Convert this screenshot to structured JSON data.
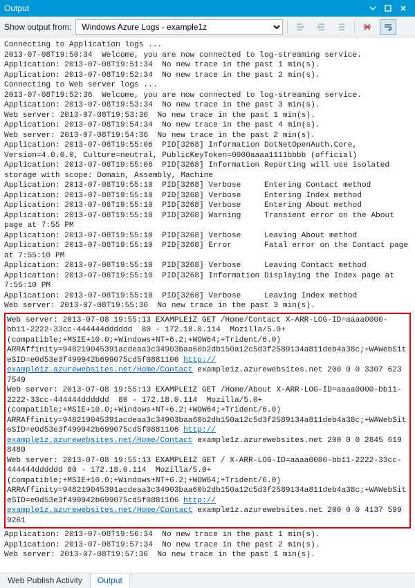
{
  "titlebar": {
    "title": "Output"
  },
  "toolbar": {
    "label": "Show output from:",
    "source": "Windows Azure Logs - example1z"
  },
  "lines": [
    "Connecting to Application logs ...",
    "2013-07-08T19:50:34  Welcome, you are now connected to log-streaming service.",
    "Application: 2013-07-08T19:51:34  No new trace in the past 1 min(s).",
    "Application: 2013-07-08T19:52:34  No new trace in the past 2 min(s).",
    "Connecting to Web server logs ...",
    "2013-07-08T19:52:36  Welcome, you are now connected to log-streaming service.",
    "Application: 2013-07-08T19:53:34  No new trace in the past 3 min(s).",
    "Web server: 2013-07-08T19:53:36  No new trace in the past 1 min(s).",
    "Application: 2013-07-08T19:54:34  No new trace in the past 4 min(s).",
    "Web server: 2013-07-08T19:54:36  No new trace in the past 2 min(s).",
    "Application: 2013-07-08T19:55:06  PID[3268] Information DotNetOpenAuth.Core, Version=4.0.0.0, Culture=neutral, PublicKeyToken=0000aaaa1111bbbb (official)",
    "Application: 2013-07-08T19:55:06  PID[3268] Information Reporting will use isolated storage with scope: Domain, Assembly, Machine",
    "Application: 2013-07-08T19:55:10  PID[3268] Verbose     Entering Contact method",
    "Application: 2013-07-08T19:55:10  PID[3268] Verbose     Entering Index method",
    "Application: 2013-07-08T19:55:10  PID[3268] Verbose     Entering About method",
    "Application: 2013-07-08T19:55:10  PID[3268] Warning     Transient error on the About page at 7:55 PM",
    "Application: 2013-07-08T19:55:10  PID[3268] Verbose     Leaving About method",
    "Application: 2013-07-08T19:55:10  PID[3268] Error       Fatal error on the Contact page at 7:55:10 PM",
    "Application: 2013-07-08T19:55:10  PID[3268] Verbose     Leaving Contact method",
    "Application: 2013-07-08T19:55:10  PID[3268] Information Displaying the Index page at 7:55:10 PM",
    "Application: 2013-07-08T19:55:10  PID[3268] Verbose     Leaving Index method",
    "Web server: 2013-07-08T19:55:36  No new trace in the past 3 min(s)."
  ],
  "box": [
    {
      "pre": "Web server: 2013-07-08 19:55:13 EXAMPLE1Z GET /Home/Contact X-ARR-LOG-ID=aaaa0000-bb11-2222-33cc-444444dddddd  80 - 172.18.0.114  Mozilla/5.0+(compatible;+MSIE+10.0;+Windows+NT+6.2;+WOW64;+Trident/6.0) ARRAffinity=948219045391acdeaa3c34903baa60b2db150a12c5d3f2589134a811deb4a38c;+WAWebSiteSID=e0d53e3f499942b699075cd5f0881106 ",
      "link1": "http://",
      "link2": "example1z.azurewebsites.net/Home/Contact",
      "post": " example1z.azurewebsites.net 200 0 0 3307 623 7549"
    },
    {
      "pre": "Web server: 2013-07-08 19:55:13 EXAMPLE1Z GET /Home/About X-ARR-LOG-ID=aaaa0000-bb11-2222-33cc-444444dddddd  80 - 172.18.0.114  Mozilla/5.0+(compatible;+MSIE+10.0;+Windows+NT+6.2;+WOW64;+Trident/6.0) ARRAffinity=948219045391acdeaa3c34903baa60b2db150a12c5d3f2589134a811deb4a38c;+WAWebSiteSID=e0d53e3f499942b699075cd5f0881106 ",
      "link1": "http://",
      "link2": "example1z.azurewebsites.net/Home/Contact",
      "post": " example1z.azurewebsites.net 200 0 0 2845 619 8480"
    },
    {
      "pre": "Web server: 2013-07-08 19:55:13 EXAMPLE1Z GET / X-ARR-LOG-ID=aaaa0000-bb11-2222-33cc-444444dddddd 80 - 172.18.0.114  Mozilla/5.0+(compatible;+MSIE+10.0;+Windows+NT+6.2;+WOW64;+Trident/6.0) ARRAffinity=948219045391acdeaa3c34903baa60b2db150a12c5d3f2589134a811deb4a38c;+WAWebSiteSID=e0d53e3f499942b699075cd5f0881106 ",
      "link1": "http://",
      "link2": "example1z.azurewebsites.net/Home/Contact",
      "post": " example1z.azurewebsites.net 200 0 0 4137 599 9261"
    }
  ],
  "after": [
    "Application: 2013-07-08T19:56:34  No new trace in the past 1 min(s).",
    "Application: 2013-07-08T19:57:34  No new trace in the past 2 min(s).",
    "Web server: 2013-07-08T19:57:36  No new trace in the past 1 min(s).",
    ""
  ],
  "footer": {
    "tab1": "Web Publish Activity",
    "tab2": "Output"
  }
}
